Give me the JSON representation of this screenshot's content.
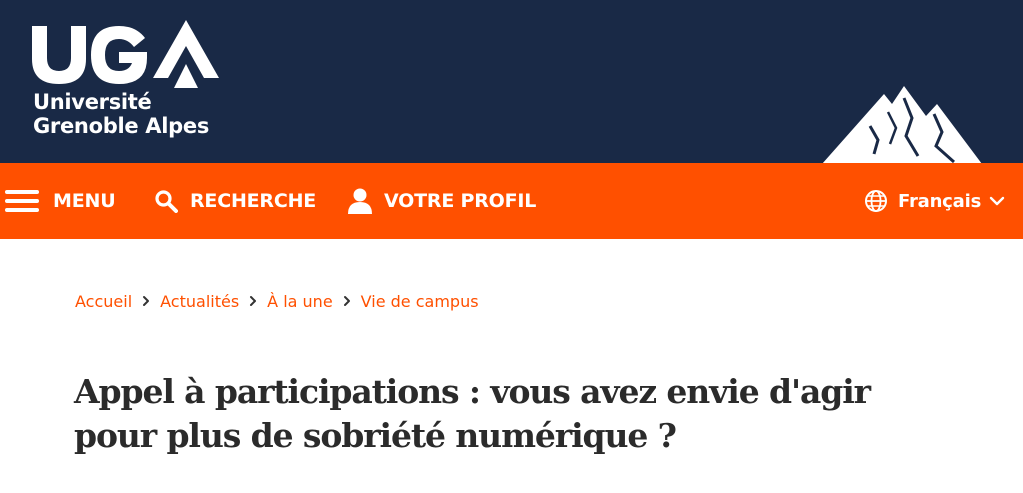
{
  "logo": {
    "letters": "UGA",
    "line1": "Université",
    "line2": "Grenoble Alpes"
  },
  "nav": {
    "menu_label": "MENU",
    "search_label": "RECHERCHE",
    "profile_label": "VOTRE PROFIL",
    "language_label": "Français"
  },
  "breadcrumb": {
    "items": [
      "Accueil",
      "Actualités",
      "À la une",
      "Vie de campus"
    ]
  },
  "article": {
    "title_line1": "Appel à participations : vous avez envie d'agir",
    "title_line2": "pour plus de sobriété numérique ?"
  },
  "colors": {
    "header_bg": "#192946",
    "accent": "#ff5000",
    "title_text": "#2b2b2b"
  },
  "icons": [
    "menu-icon",
    "search-icon",
    "user-icon",
    "globe-icon",
    "chevron-down-icon",
    "chevron-right-icon",
    "mountain-logo-icon"
  ]
}
